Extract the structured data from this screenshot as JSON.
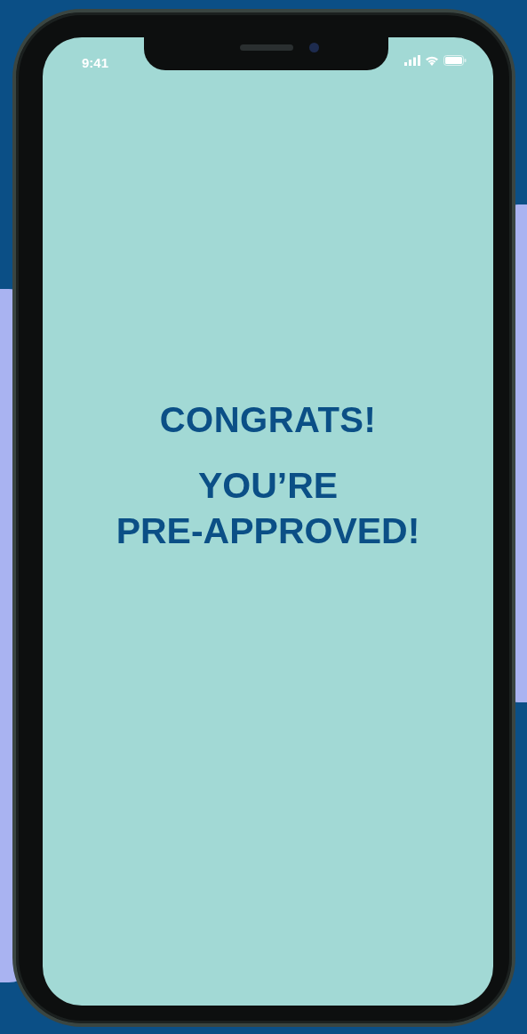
{
  "status_bar": {
    "time": "9:41"
  },
  "heading": "CONGRATS!",
  "message_lines": [
    "YOU’RE",
    "PRE-APPROVED!"
  ]
}
